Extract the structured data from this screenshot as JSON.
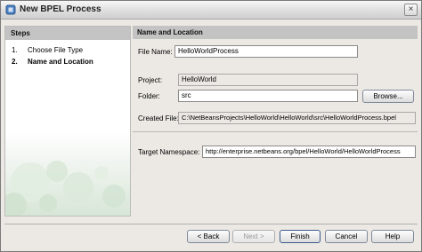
{
  "window": {
    "title": "New BPEL Process"
  },
  "steps": {
    "header": "Steps",
    "items": [
      {
        "num": "1.",
        "label": "Choose File Type"
      },
      {
        "num": "2.",
        "label": "Name and Location"
      }
    ]
  },
  "content": {
    "header": "Name and Location",
    "file_name": {
      "label": "File Name:",
      "value": "HelloWorldProcess"
    },
    "project": {
      "label": "Project:",
      "value": "HelloWorld"
    },
    "folder": {
      "label": "Folder:",
      "value": "src",
      "browse_label": "Browse..."
    },
    "created_file": {
      "label": "Created File:",
      "value": "C:\\NetBeansProjects\\HelloWorld\\HelloWorld\\src\\HelloWorldProcess.bpel"
    },
    "target_namespace": {
      "label": "Target Namespace:",
      "value": "http://enterprise.netbeans.org/bpel/HelloWorld/HelloWorldProcess"
    }
  },
  "buttons": {
    "back": "< Back",
    "next": "Next >",
    "finish": "Finish",
    "cancel": "Cancel",
    "help": "Help"
  }
}
